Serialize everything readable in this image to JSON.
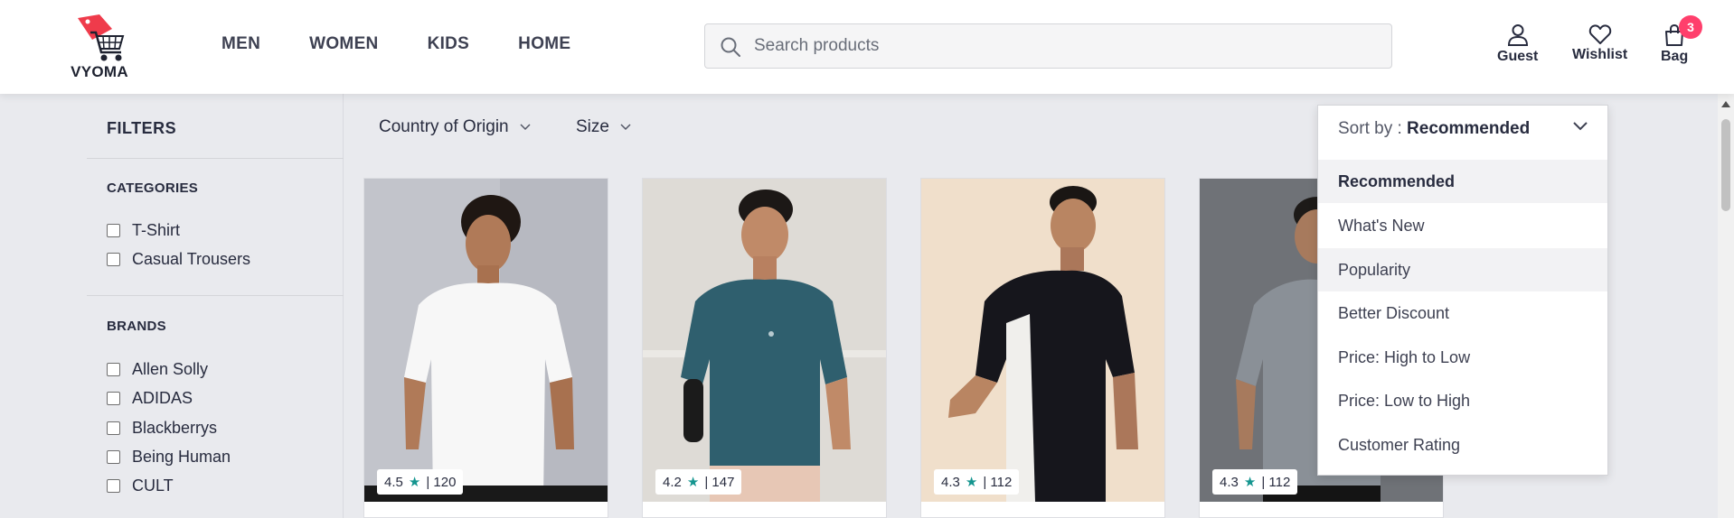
{
  "brand": {
    "name": "VYOMA"
  },
  "nav": [
    {
      "label": "MEN"
    },
    {
      "label": "WOMEN"
    },
    {
      "label": "KIDS"
    },
    {
      "label": "HOME"
    }
  ],
  "search": {
    "placeholder": "Search products",
    "value": ""
  },
  "header_actions": {
    "profile": "Guest",
    "wishlist": "Wishlist",
    "bag": "Bag",
    "bag_count": "3"
  },
  "sidebar": {
    "title": "FILTERS",
    "categories_title": "CATEGORIES",
    "categories": [
      "T-Shirt",
      "Casual Trousers"
    ],
    "brands_title": "BRANDS",
    "brands": [
      "Allen Solly",
      "ADIDAS",
      "Blackberrys",
      "Being Human",
      "CULT"
    ]
  },
  "top_filters": [
    "Country of Origin",
    "Size"
  ],
  "sort": {
    "prefix": "Sort by : ",
    "selected": "Recommended",
    "options": [
      "Recommended",
      "What's New",
      "Popularity",
      "Better Discount",
      "Price: High to Low",
      "Price: Low to High",
      "Customer Rating"
    ]
  },
  "products": [
    {
      "rating": "4.5",
      "count": "120",
      "shirt_color": "#ffffff"
    },
    {
      "rating": "4.2",
      "count": "147",
      "shirt_color": "#2f5f6e"
    },
    {
      "rating": "4.3",
      "count": "112",
      "shirt_color": "#16161c"
    },
    {
      "rating": "4.3",
      "count": "112",
      "shirt_color": "#7b8189"
    }
  ],
  "colors": {
    "accent": "#ff3f6c",
    "rating_star": "#14958f",
    "text": "#282c3f"
  }
}
